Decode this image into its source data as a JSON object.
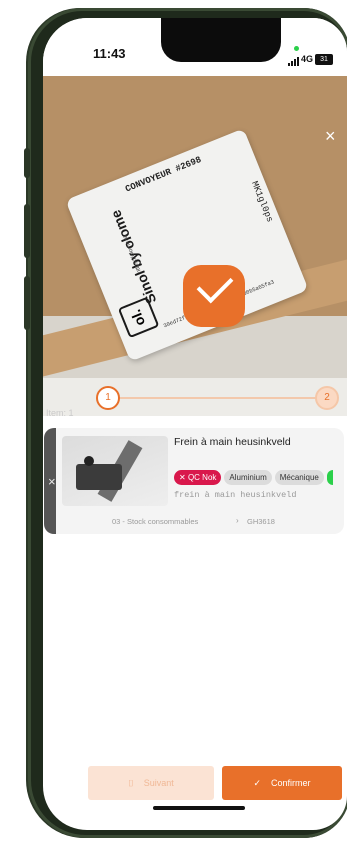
{
  "status_bar": {
    "time": "11:43",
    "network": "4G",
    "battery": "31"
  },
  "camera": {
    "label_title": "CONVOYEUR #2698",
    "label_brand": "Sinol by olome",
    "label_url": "https://olome.io",
    "label_logo": "ol.",
    "label_uuid": "30ed72f0-5a6c-4de4-a411-0a30b5a65fa3",
    "label_code": "MK1gl0ps",
    "close_icon": "×",
    "check_icon": "check-icon"
  },
  "stepper": {
    "step_1": "1",
    "step_2": "2"
  },
  "item_count": "Item: 1",
  "item": {
    "remove_icon": "×",
    "title": "Frein à main heusinkveld",
    "tags": {
      "qc_status": "QC Nok",
      "material": "Aluminium",
      "category": "Mécanique"
    },
    "description": "frein à main heusinkveld",
    "location": "03 - Stock consommables",
    "chevron": "›",
    "sku": "GH3618"
  },
  "footer": {
    "previous_label": "Suivant",
    "previous_icon": "⌷",
    "confirm_label": "Confirmer",
    "confirm_icon": "✓"
  },
  "colors": {
    "accent": "#e8702a",
    "danger": "#d9184c",
    "phone_frame": "#1f2a1c"
  }
}
